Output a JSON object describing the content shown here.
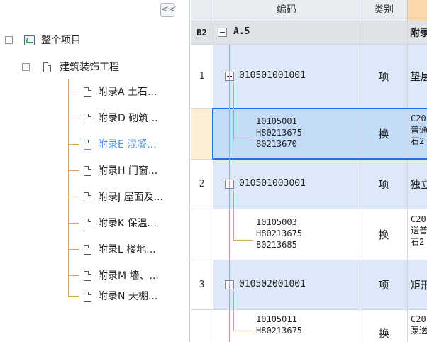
{
  "tree": {
    "collapse_glyph": "<<",
    "root": {
      "label": "整个项目",
      "icon": "project-icon"
    },
    "project": {
      "label": "建筑装饰工程",
      "icon": "document-icon"
    },
    "items": [
      {
        "label": "附录A 土石...",
        "selected": false
      },
      {
        "label": "附录D 砌筑...",
        "selected": false
      },
      {
        "label": "附录E 混凝...",
        "selected": true
      },
      {
        "label": "附录H 门窗...",
        "selected": false
      },
      {
        "label": "附录J 屋面及...",
        "selected": false
      },
      {
        "label": "附录K 保温...",
        "selected": false
      },
      {
        "label": "附录L 楼地...",
        "selected": false
      },
      {
        "label": "附录M 墙、...",
        "selected": false
      },
      {
        "label": "附录N 天棚...",
        "selected": false
      }
    ]
  },
  "grid": {
    "headers": {
      "code": "编码",
      "category": "类别",
      "name": ""
    },
    "section_row": {
      "num": "B2",
      "code": "A.5",
      "name": "附录"
    },
    "rows": [
      {
        "num": "1",
        "code": "010501001001",
        "category": "项",
        "name": "垫层"
      },
      {
        "num": "",
        "code_lines": [
          "10105001",
          "H80213675",
          "80213670"
        ],
        "category": "换",
        "desc_lines": [
          "C20",
          "普通",
          "石2"
        ]
      },
      {
        "num": "2",
        "code": "010501003001",
        "category": "项",
        "name": "独立"
      },
      {
        "num": "",
        "code_lines": [
          "10105003",
          "H80213675",
          "80213685"
        ],
        "category": "换",
        "desc_lines": [
          "C20",
          "送普",
          "石2"
        ]
      },
      {
        "num": "3",
        "code": "010502001001",
        "category": "项",
        "name": "矩形"
      },
      {
        "num": "",
        "code_lines": [
          "10105011",
          "H80213675"
        ],
        "category": "换",
        "desc_lines": [
          "C20",
          "泵送"
        ]
      }
    ]
  },
  "colors": {
    "header_bg": "#e9ecf0",
    "section_bg": "#dfe2e6",
    "item_row_bg": "#dde9f8",
    "selected_row_bg": "#c4dcf8",
    "selected_num_bg": "#fdeed8",
    "selection_border": "#1a6fe6",
    "tree_selected_text": "#4b8fe8",
    "tree_connector": "#d8a35a"
  }
}
